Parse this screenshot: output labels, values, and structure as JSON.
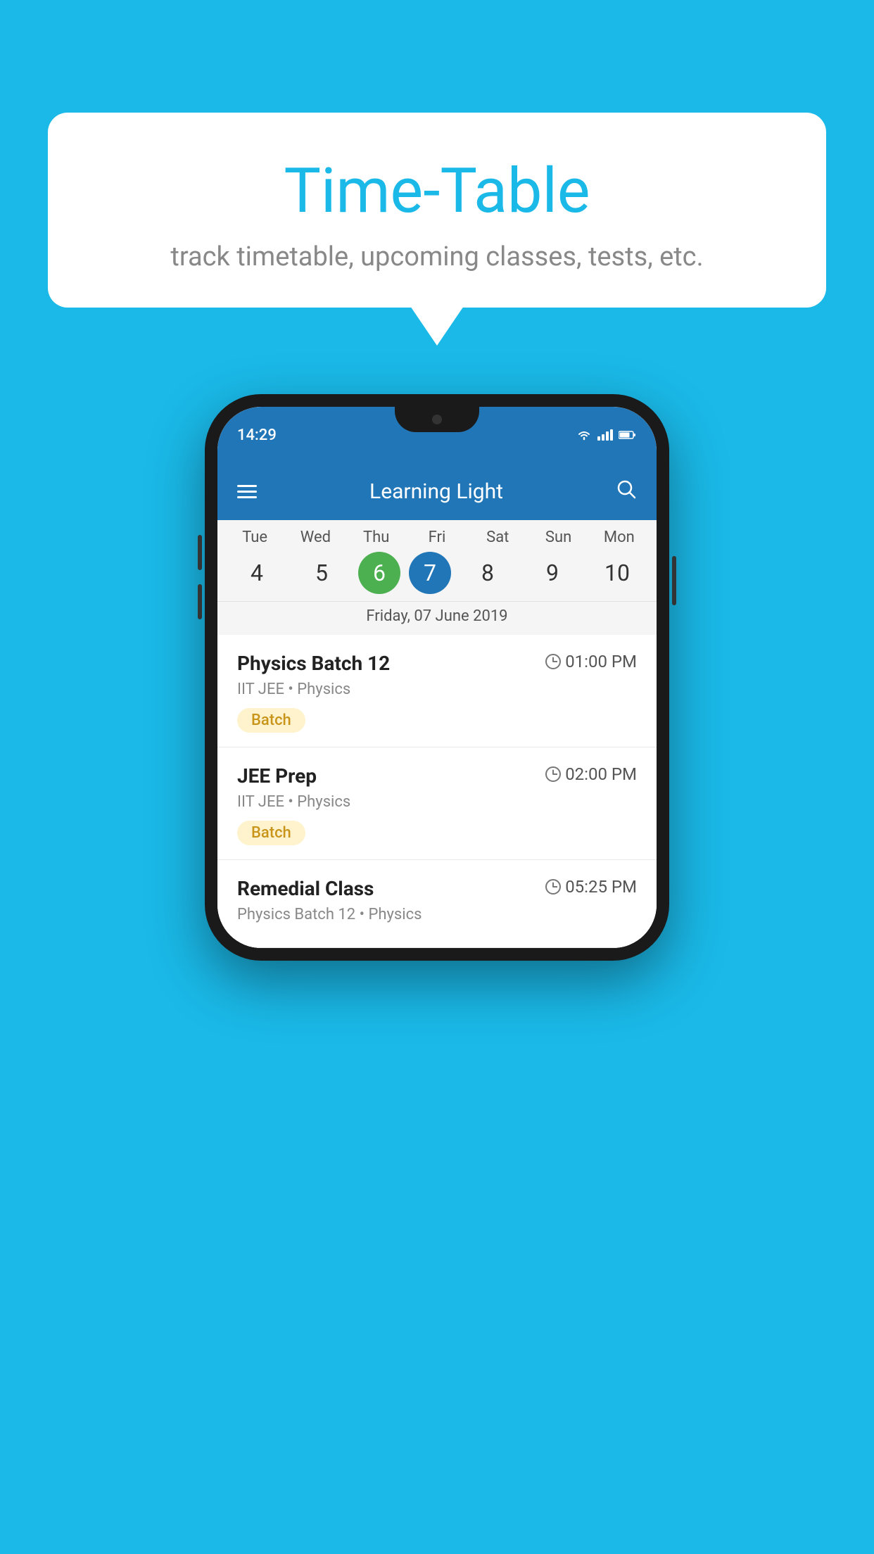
{
  "background_color": "#1ab9e8",
  "bubble": {
    "title": "Time-Table",
    "subtitle": "track timetable, upcoming classes, tests, etc."
  },
  "phone": {
    "status_bar": {
      "time": "14:29",
      "icons": [
        "wifi",
        "signal",
        "battery"
      ]
    },
    "app_header": {
      "title": "Learning Light"
    },
    "calendar": {
      "days_of_week": [
        "Tue",
        "Wed",
        "Thu",
        "Fri",
        "Sat",
        "Sun",
        "Mon"
      ],
      "dates": [
        "4",
        "5",
        "6",
        "7",
        "8",
        "9",
        "10"
      ],
      "today_green_index": 2,
      "today_blue_index": 3,
      "current_date_label": "Friday, 07 June 2019"
    },
    "classes": [
      {
        "name": "Physics Batch 12",
        "time": "01:00 PM",
        "meta": "IIT JEE • Physics",
        "badge": "Batch"
      },
      {
        "name": "JEE Prep",
        "time": "02:00 PM",
        "meta": "IIT JEE • Physics",
        "badge": "Batch"
      },
      {
        "name": "Remedial Class",
        "time": "05:25 PM",
        "meta": "Physics Batch 12 • Physics",
        "badge": null
      }
    ]
  }
}
